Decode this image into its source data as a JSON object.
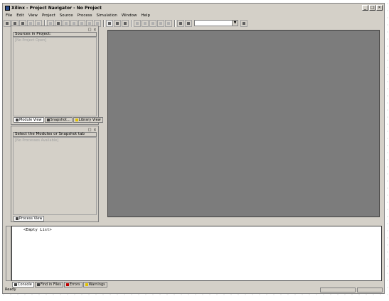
{
  "window": {
    "title": "Xilinx - Project Navigator - No Project"
  },
  "menu": [
    "File",
    "Edit",
    "View",
    "Project",
    "Source",
    "Process",
    "Simulation",
    "Window",
    "Help"
  ],
  "sources_panel": {
    "header": "Sources in Project:",
    "placeholder": "[No Project Open]",
    "tabs": [
      "Module View",
      "Snapshot...",
      "Library View"
    ]
  },
  "process_panel": {
    "header": "Select the Modules or Snapshot tab",
    "placeholder": "[No Processes Available]",
    "tabs": [
      "Process View"
    ]
  },
  "console": {
    "text": "<Empty List>",
    "tabs": [
      "Console",
      "Find in Files",
      "Errors",
      "Warnings"
    ]
  },
  "status": {
    "text": "Ready"
  },
  "colors": {
    "chrome": "#d4d0c8",
    "workspace": "#7c7c7c"
  }
}
